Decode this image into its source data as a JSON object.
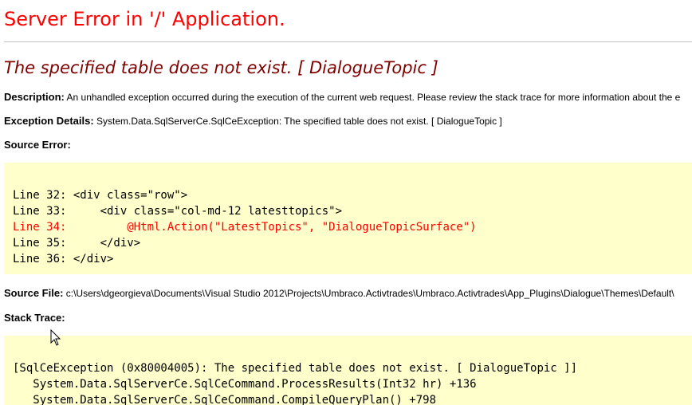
{
  "colors": {
    "title": "#ff0000",
    "subtitle": "#800000",
    "highlight": "#ff0000",
    "code_bg": "#ffffcc",
    "rule": "#c0c0c0"
  },
  "page": {
    "title": "Server Error in '/' Application.",
    "error_message": "The specified table does not exist. [ DialogueTopic ]"
  },
  "description": {
    "label": "Description:",
    "text": "An unhandled exception occurred during the execution of the current web request. Please review the stack trace for more information about the e"
  },
  "exception_details": {
    "label": "Exception Details:",
    "text": "System.Data.SqlServerCe.SqlCeException: The specified table does not exist. [ DialogueTopic ]"
  },
  "source_error": {
    "label": "Source Error:",
    "lines": [
      "Line 32: <div class=\"row\">",
      "Line 33:     <div class=\"col-md-12 latesttopics\">",
      "Line 34:         @Html.Action(\"LatestTopics\", \"DialogueTopicSurface\")",
      "Line 35:     </div>",
      "Line 36: </div>"
    ]
  },
  "source_file": {
    "label": "Source File:",
    "text": "c:\\Users\\dgeorgieva\\Documents\\Visual Studio 2012\\Projects\\Umbraco.Activtrades\\Umbraco.Activtrades\\App_Plugins\\Dialogue\\Themes\\Default\\"
  },
  "stack_trace": {
    "label": "Stack Trace:",
    "lines": [
      "[SqlCeException (0x80004005): The specified table does not exist. [ DialogueTopic ]]",
      "   System.Data.SqlServerCe.SqlCeCommand.ProcessResults(Int32 hr) +136",
      "   System.Data.SqlServerCe.SqlCeCommand.CompileQueryPlan() +798"
    ]
  },
  "icons": {
    "cursor": "mouse-pointer-icon"
  }
}
